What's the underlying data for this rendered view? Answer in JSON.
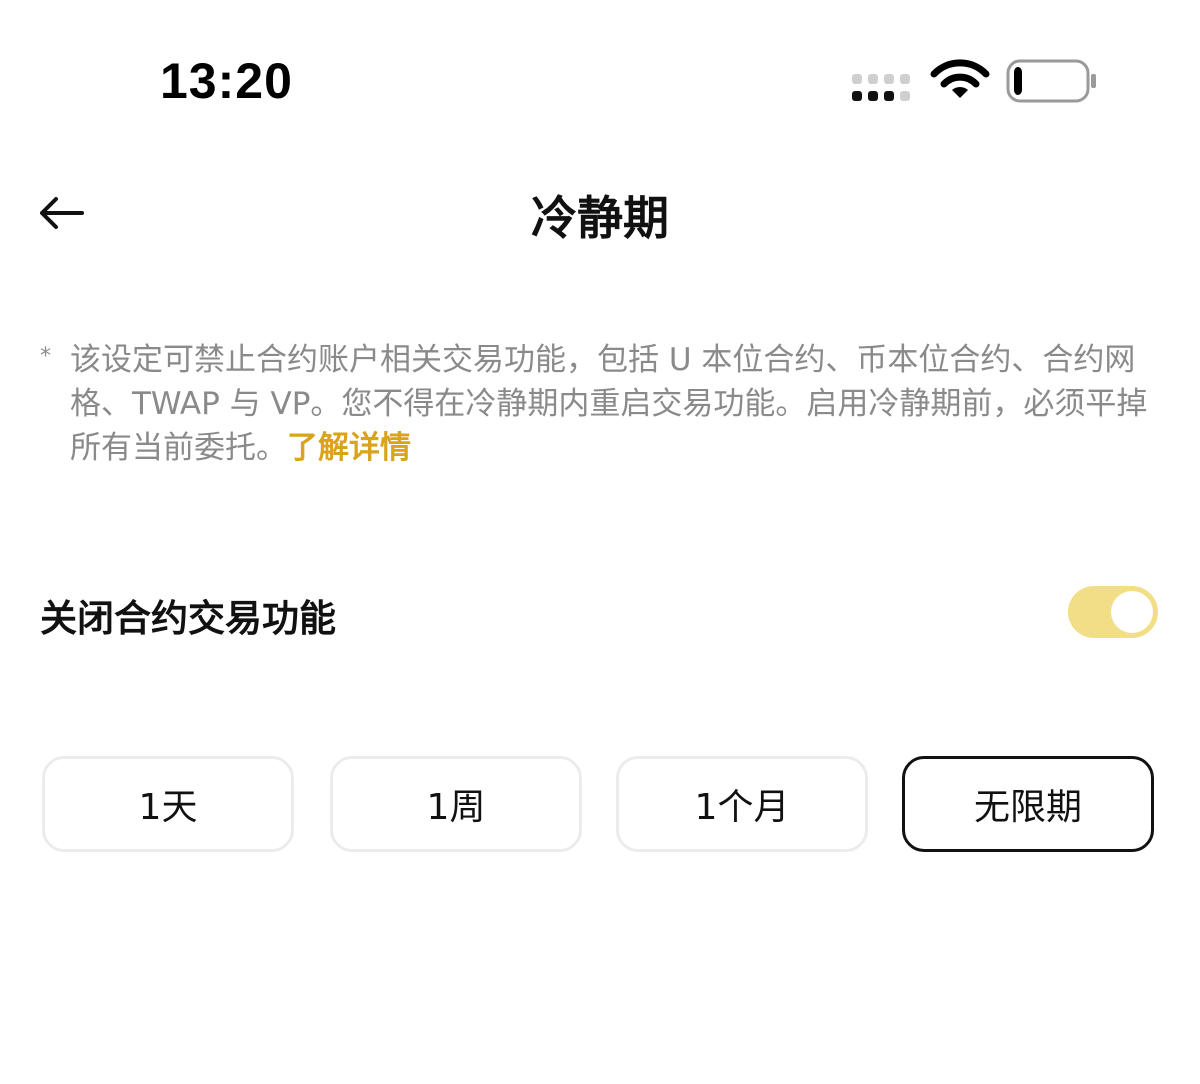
{
  "status_bar": {
    "time": "13:20",
    "icons": [
      "signal-icon",
      "wifi-icon",
      "battery-icon"
    ],
    "battery_level": 0.12
  },
  "header": {
    "title": "冷静期",
    "back_icon": "arrow-left-icon"
  },
  "notice": {
    "marker": "*",
    "text": "该设定可禁止合约账户相关交易功能，包括 U 本位合约、币本位合约、合约网格、TWAP 与 VP。您不得在冷静期内重启交易功能。启用冷静期前，必须平掉所有当前委托。",
    "link_label": "了解详情"
  },
  "setting": {
    "label": "关闭合约交易功能",
    "enabled": true
  },
  "durations": {
    "options": [
      "1天",
      "1周",
      "1个月",
      "无限期"
    ],
    "selected": "无限期"
  },
  "colors": {
    "accent": "#d9a41c",
    "toggle_track": "#f1de86",
    "muted_text": "#8a8a8a",
    "border": "#ececec"
  }
}
